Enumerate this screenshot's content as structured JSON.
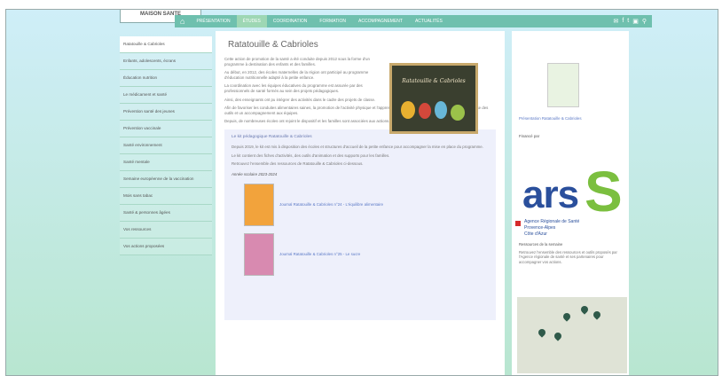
{
  "header": {
    "logo_text": "MAISON SANTE",
    "nav": [
      "Présentation",
      "Études",
      "Coordination",
      "Formation",
      "Accompagnement",
      "Actualités"
    ],
    "active_index": 1
  },
  "sidebar": {
    "items": [
      "Ratatouille & Cabrioles",
      "Enfants, adolescents, écrans",
      "Éducation nutrition",
      "Le médicament et santé",
      "Prévention santé des jeunes",
      "Prévention vaccinale",
      "Santé environnement",
      "Santé mentale",
      "Semaine européenne de la vaccination",
      "Mois sans tabac",
      "Santé & personnes âgées",
      "Vos ressources",
      "Vos actions proposées"
    ],
    "active_index": 0
  },
  "main": {
    "title": "Ratatouille & Cabrioles",
    "intro": [
      "Cette action de promotion de la santé a été conduite depuis 2012 sous la forme d'un programme à destination des enfants et des familles.",
      "Au début, en 2012, des écoles maternelles de la région ont participé au programme d'éducation nutritionnelle adapté à la petite enfance.",
      "La coordination avec les équipes éducatives du programme est assurée par des professionnels de santé formés au sein des projets pédagogiques.",
      "Ainsi, des enseignants ont pu intégrer des activités dans le cadre des projets de classe."
    ],
    "body": [
      "Afin de favoriser les conduites alimentaires saines, la promotion de l'activité physique et l'apprentissage des règles d'hygiène, le programme propose des outils et un accompagnement aux équipes.",
      "Depuis, de nombreuses écoles ont rejoint le dispositif et les familles sont associées aux actions."
    ],
    "box": {
      "title": "Le kit pédagogique Ratatouille & Cabrioles",
      "text": [
        "Depuis 2019, le kit est mis à disposition des écoles et structures d'accueil de la petite enfance pour accompagner la mise en place du programme.",
        "Le kit contient des fiches d'activités, des outils d'animation et des supports pour les familles.",
        "Retrouvez l'ensemble des ressources de Ratatouille & Cabrioles ci-dessous."
      ],
      "subheading": "Année scolaire 2023-2024",
      "docs": [
        "Journal Ratatouille & Cabrioles n°24 - L'équilibre alimentaire",
        "Journal Ratatouille & Cabrioles n°25 - Le sucre"
      ]
    }
  },
  "right": {
    "guide_link": "Présentation Ratatouille & Cabrioles",
    "partner_label": "Financé par",
    "ars": {
      "logo_letters": "ars",
      "line1": "Agence Régionale de Santé",
      "line2": "Provence-Alpes",
      "line3": "Côte d'Azur"
    },
    "info_title": "Ressources de la semaine",
    "info_text": "Retrouvez l'ensemble des ressources et outils proposés par l'Agence régionale de santé et ses partenaires pour accompagner vos actions."
  },
  "colors": {
    "nav_bg": "#6fc0ae",
    "ars_blue": "#2a4f9c",
    "ars_green": "#7bbf3f"
  }
}
